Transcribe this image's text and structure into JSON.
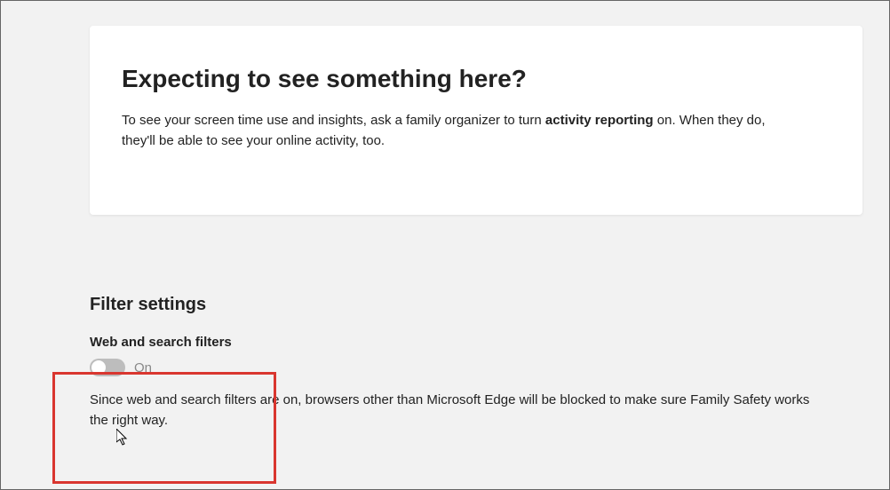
{
  "card": {
    "title": "Expecting to see something here?",
    "text_before": "To see your screen time use and insights, ask a family organizer to turn ",
    "text_strong": "activity reporting",
    "text_after": " on. When they do, they'll be able to see your online activity, too."
  },
  "filter_section": {
    "title": "Filter settings",
    "subtitle": "Web and search filters",
    "toggle_state": "On",
    "description": "Since web and search filters are on, browsers other than Microsoft Edge will be blocked to make sure Family Safety works the right way."
  }
}
